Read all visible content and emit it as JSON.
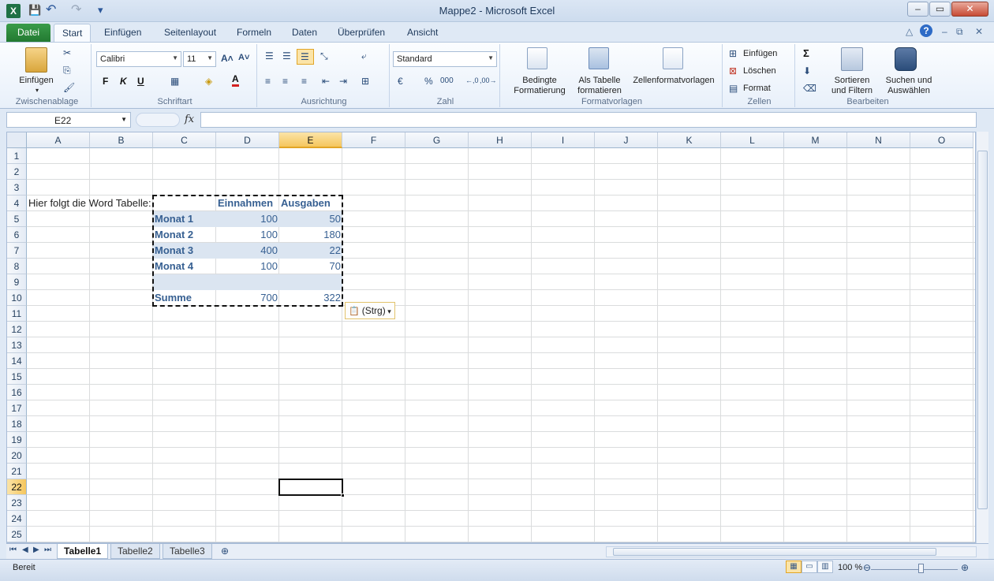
{
  "window": {
    "title": "Mappe2  -  Microsoft Excel",
    "app_glyph": "X",
    "minimize": "–",
    "maximize": "▭",
    "close": "✕"
  },
  "quick_access": {
    "save": "💾",
    "undo": "↶",
    "redo": "↷",
    "customize": "▾"
  },
  "ribbon_tabs": [
    "Datei",
    "Start",
    "Einfügen",
    "Seitenlayout",
    "Formeln",
    "Daten",
    "Überprüfen",
    "Ansicht"
  ],
  "active_tab": "Start",
  "ribbon_right_icons": {
    "minimize_ribbon": "△",
    "help": "?",
    "win_min": "–",
    "win_restore": "⧉",
    "win_close": "✕"
  },
  "clipboard": {
    "paste_label": "Einfügen",
    "group_label": "Zwischenablage",
    "cut": "✂",
    "copy": "⎘",
    "format_painter": "🖌"
  },
  "font": {
    "font_name": "Calibri",
    "font_size": "11",
    "grow": "A˄",
    "shrink": "A˅",
    "bold": "F",
    "italic": "K",
    "underline": "U",
    "border": "▦",
    "fill": "◈",
    "font_color": "A",
    "group_label": "Schriftart"
  },
  "alignment": {
    "group_label": "Ausrichtung"
  },
  "number": {
    "format": "Standard",
    "currency": "€",
    "percent": "%",
    "thousands": "000",
    "inc_decimal": "←,0",
    "dec_decimal": ",00→",
    "group_label": "Zahl"
  },
  "styles": {
    "conditional": "Bedingte\nFormatierung",
    "as_table": "Als Tabelle\nformatieren",
    "cell_styles": "Zellenformatvorlagen",
    "group_label": "Formatvorlagen"
  },
  "cells": {
    "insert": "Einfügen",
    "delete": "Löschen",
    "format": "Format",
    "group_label": "Zellen"
  },
  "editing": {
    "autosum": "Σ",
    "fill": "⬇",
    "clear": "⌫",
    "sort": "Sortieren\nund Filtern",
    "find": "Suchen und\nAuswählen",
    "group_label": "Bearbeiten"
  },
  "formula_bar": {
    "name_box": "E22",
    "fx": "fx",
    "value": ""
  },
  "columns": [
    "A",
    "B",
    "C",
    "D",
    "E",
    "F",
    "G",
    "H",
    "I",
    "J",
    "K",
    "L",
    "M",
    "N",
    "O"
  ],
  "selected_column": "E",
  "rows": [
    1,
    2,
    3,
    4,
    5,
    6,
    7,
    8,
    9,
    10,
    11,
    12,
    13,
    14,
    15,
    16,
    17,
    18,
    19,
    20,
    21,
    22,
    23,
    24,
    25
  ],
  "selected_row": 22,
  "sheet": {
    "a4": "Hier folgt die Word Tabelle:",
    "table_header": [
      "",
      "Einnahmen",
      "Ausgaben"
    ],
    "table_rows": [
      [
        "Monat 1",
        "100",
        "50"
      ],
      [
        "Monat 2",
        "100",
        "180"
      ],
      [
        "Monat 3",
        "400",
        "22"
      ],
      [
        "Monat 4",
        "100",
        "70"
      ],
      [
        "",
        "",
        ""
      ],
      [
        "Summe",
        "700",
        "322"
      ]
    ]
  },
  "paste_options": "(Strg)",
  "sheet_tabs": [
    "Tabelle1",
    "Tabelle2",
    "Tabelle3"
  ],
  "active_sheet": "Tabelle1",
  "status": {
    "text": "Bereit",
    "zoom": "100 %"
  },
  "colors": {
    "band": "#dbe5f1",
    "header_text": "#376092",
    "selected_header": "#f5c65d"
  }
}
